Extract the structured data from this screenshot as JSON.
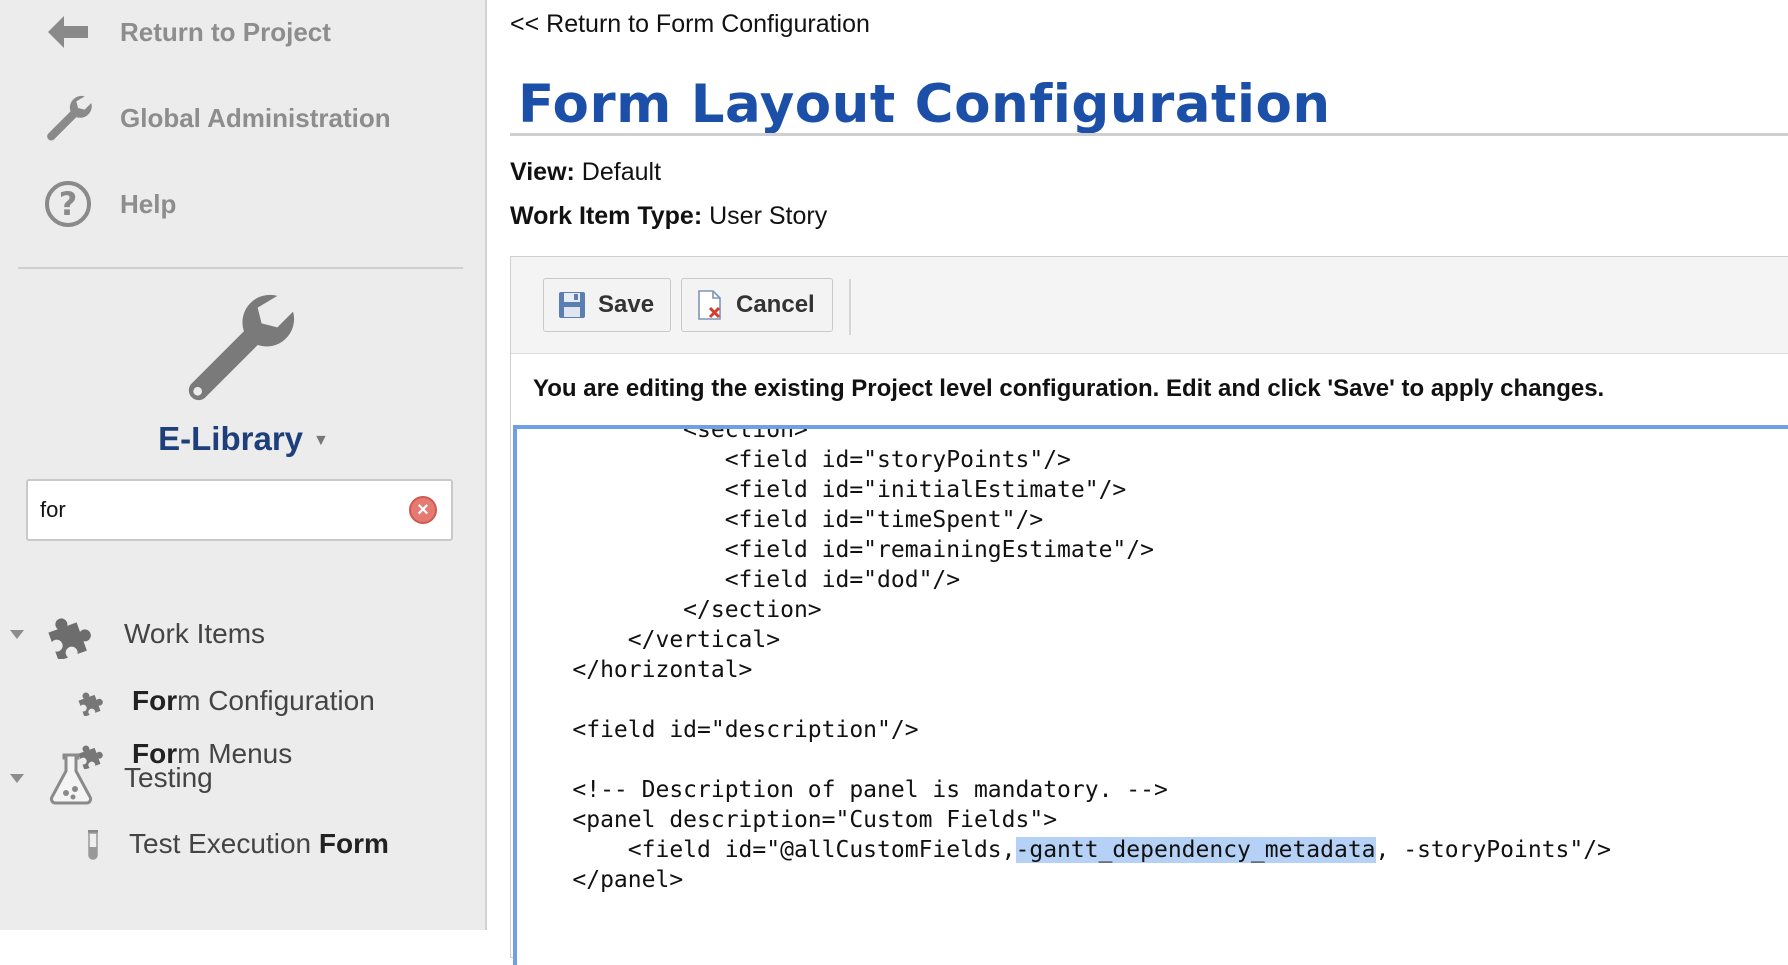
{
  "sidebar": {
    "nav": [
      {
        "label": "Return to Project",
        "icon": "arrow-left-icon"
      },
      {
        "label": "Global Administration",
        "icon": "wrench-icon"
      },
      {
        "label": "Help",
        "icon": "help-icon"
      }
    ],
    "library": {
      "title": "E-Library",
      "icon": "wrench-icon"
    },
    "search": {
      "value": "for"
    },
    "tree": [
      {
        "label": "Work Items",
        "icon": "puzzle-icon",
        "expanded": true,
        "children": [
          {
            "label_match": "For",
            "label_rest": "m Configuration",
            "icon": "puzzle-icon"
          },
          {
            "label_match": "For",
            "label_rest": "m Menus",
            "icon": "puzzle-icon"
          }
        ]
      },
      {
        "label": "Testing",
        "icon": "flask-icon",
        "expanded": true,
        "children": [
          {
            "label_pre": "Test Execution ",
            "label_match": "Form",
            "icon": "test-tube-icon"
          }
        ]
      }
    ]
  },
  "main": {
    "back_link": "<< Return to Form Configuration",
    "title": "Form Layout Configuration",
    "view_label": "View:",
    "view_value": "Default",
    "type_label": "Work Item Type:",
    "type_value": "User Story",
    "toolbar": {
      "save_label": "Save",
      "cancel_label": "Cancel"
    },
    "info_message": "You are editing the existing Project level configuration. Edit and click 'Save' to apply changes.",
    "code": {
      "lines": [
        "            <section>",
        "               <field id=\"storyPoints\"/>",
        "               <field id=\"initialEstimate\"/>",
        "               <field id=\"timeSpent\"/>",
        "               <field id=\"remainingEstimate\"/>",
        "               <field id=\"dod\"/>",
        "            </section>",
        "        </vertical>",
        "    </horizontal>",
        "",
        "    <field id=\"description\"/>",
        "",
        "    <!-- Description of panel is mandatory. -->",
        "    <panel description=\"Custom Fields\">",
        "        <field id=\"@allCustomFields,",
        "    </panel>"
      ],
      "highlight_line_selected": "-gantt_dependency_metadata",
      "highlight_line_rest": ", -storyPoints\"/>"
    }
  },
  "colors": {
    "title_blue": "#1c4fa8",
    "library_blue": "#1e3f7a",
    "selection": "#b5d1f5",
    "focus_border": "#6f9fe8"
  }
}
